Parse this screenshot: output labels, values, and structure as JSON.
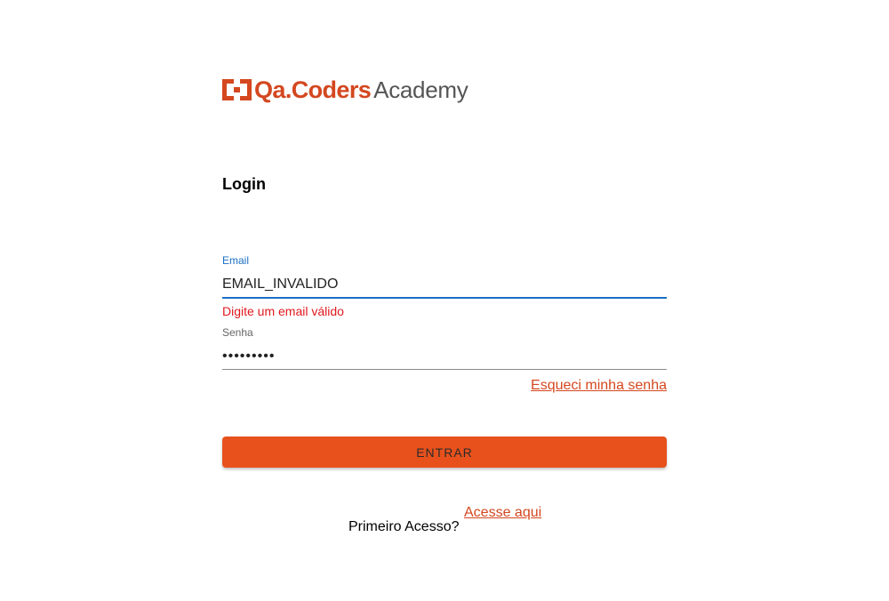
{
  "logo": {
    "brand": "Qa.Coders",
    "sub": "Academy",
    "brand_color": "#d4471f"
  },
  "login": {
    "title": "Login",
    "email": {
      "label": "Email",
      "value": "EMAIL_INVALIDO",
      "error": "Digite um email válido"
    },
    "password": {
      "label": "Senha",
      "value": "•••••••••"
    },
    "forgot_link": "Esqueci minha senha",
    "submit_label": "ENTRAR",
    "submit_color": "#e8511c",
    "first_access_text": "Primeiro Acesso?",
    "first_access_link": "Acesse aqui"
  }
}
